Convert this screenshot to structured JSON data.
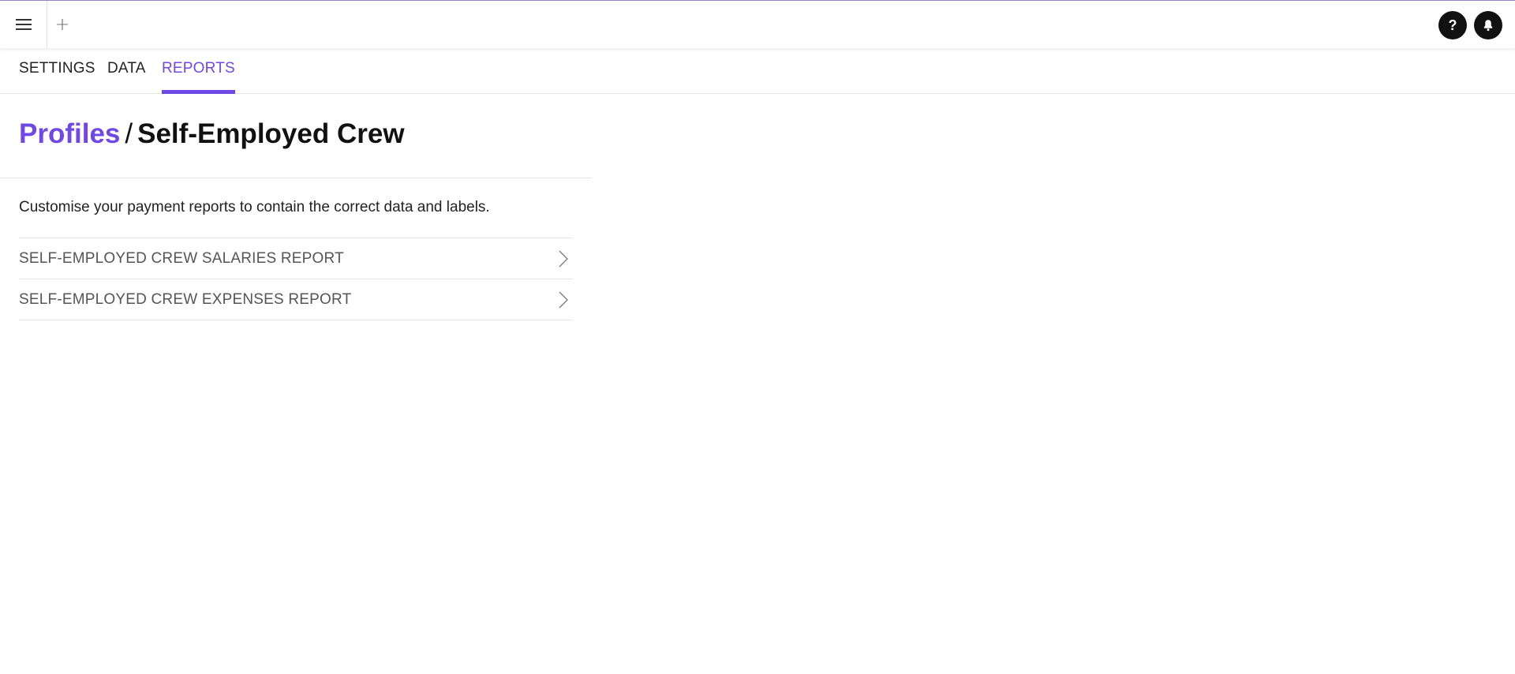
{
  "topbar": {
    "menu_icon": "hamburger-menu-icon",
    "add_label": "+",
    "help_label": "?",
    "bell_icon": "bell-icon"
  },
  "tabs": [
    {
      "label": "SETTINGS",
      "active": false
    },
    {
      "label": "DATA",
      "active": false
    },
    {
      "label": "REPORTS",
      "active": true
    }
  ],
  "breadcrumb": {
    "parent": "Profiles",
    "separator": "/",
    "current": "Self-Employed Crew"
  },
  "description": "Customise your payment reports to contain the correct data and labels.",
  "reports": [
    {
      "label": "SELF-EMPLOYED CREW SALARIES REPORT",
      "icon": "chevron-right-icon"
    },
    {
      "label": "SELF-EMPLOYED CREW EXPENSES REPORT",
      "icon": "chevron-right-icon"
    }
  ],
  "colors": {
    "accent": "#7048e8",
    "top_border": "#9b7fc9",
    "text": "#111111",
    "muted_text": "#555555",
    "divider": "#e4e4e4"
  }
}
